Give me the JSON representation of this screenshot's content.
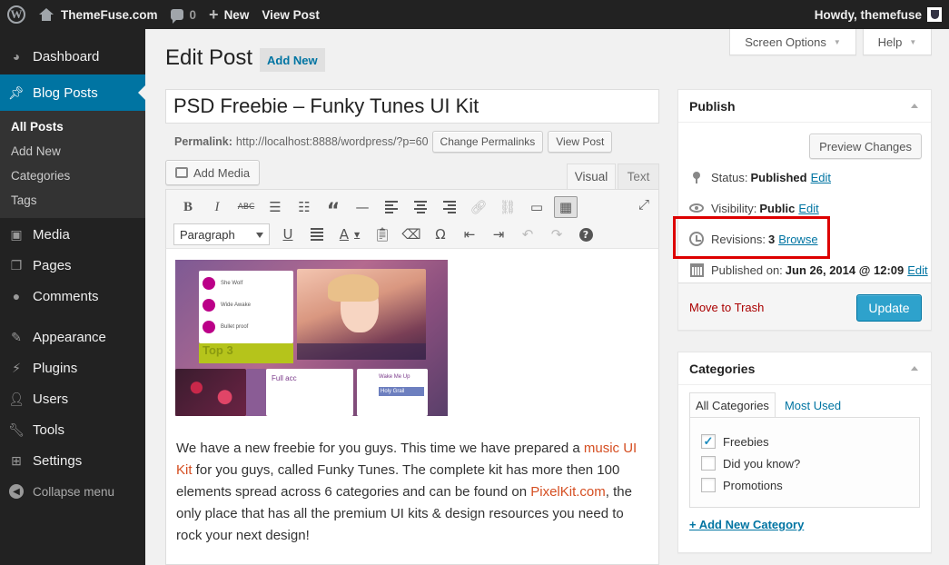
{
  "adminbar": {
    "site_name": "ThemeFuse.com",
    "comments_count": "0",
    "new_label": "New",
    "view_post": "View Post",
    "howdy": "Howdy, themefuse"
  },
  "sidebar": {
    "items": [
      {
        "label": "Dashboard",
        "icon": "dashboard-icon"
      },
      {
        "label": "Blog Posts",
        "icon": "pushpin-icon",
        "current": true
      },
      {
        "label": "Media",
        "icon": "media-icon"
      },
      {
        "label": "Pages",
        "icon": "pages-icon"
      },
      {
        "label": "Comments",
        "icon": "comments-icon"
      },
      {
        "label": "Appearance",
        "icon": "brush-icon"
      },
      {
        "label": "Plugins",
        "icon": "plugin-icon"
      },
      {
        "label": "Users",
        "icon": "users-icon"
      },
      {
        "label": "Tools",
        "icon": "wrench-icon"
      },
      {
        "label": "Settings",
        "icon": "settings-icon"
      }
    ],
    "submenu": [
      "All Posts",
      "Add New",
      "Categories",
      "Tags"
    ],
    "collapse": "Collapse menu"
  },
  "screen_options": "Screen Options",
  "help": "Help",
  "page": {
    "title": "Edit Post",
    "add_new": "Add New"
  },
  "post": {
    "title": "PSD Freebie – Funky Tunes UI Kit",
    "permalink_label": "Permalink:",
    "permalink_url": "http://localhost:8888/wordpress/?p=60",
    "change_permalinks": "Change Permalinks",
    "view_post": "View Post"
  },
  "editor": {
    "add_media": "Add Media",
    "tab_visual": "Visual",
    "tab_text": "Text",
    "format": "Paragraph",
    "image_text": {
      "r1": "She Wolf",
      "r2": "Wide Awake",
      "r3": "Bullet proof",
      "top": "Top 3",
      "full": "Full acc",
      "wake": "Wake Me Up",
      "holy": "Holy Grail"
    },
    "content": {
      "p1a": "We have a new freebie for you guys. This time we have prepared a ",
      "link1": "music UI Kit",
      "p1b": " for you guys, called Funky Tunes. The complete kit has more then 100 elements spread across 6 categories and can be found on ",
      "link2": "PixelKit.com",
      "p1c": ", the only place that has all the premium UI kits & design resources you need to rock your next design!"
    }
  },
  "publish": {
    "title": "Publish",
    "preview": "Preview Changes",
    "status_label": "Status:",
    "status_value": "Published",
    "visibility_label": "Visibility:",
    "visibility_value": "Public",
    "revisions_label": "Revisions:",
    "revisions_value": "3",
    "browse": "Browse",
    "published_on_label": "Published on:",
    "published_on_value": "Jun 26, 2014 @ 12:09",
    "edit": "Edit",
    "trash": "Move to Trash",
    "update": "Update"
  },
  "categories": {
    "title": "Categories",
    "tab_all": "All Categories",
    "tab_used": "Most Used",
    "items": [
      {
        "label": "Freebies",
        "checked": true
      },
      {
        "label": "Did you know?",
        "checked": false
      },
      {
        "label": "Promotions",
        "checked": false
      }
    ],
    "add_new": "+ Add New Category"
  },
  "colors": {
    "admin_bar": "#222222",
    "menu_current": "#0074a2",
    "link": "#0074a2",
    "update_button": "#2ea2cc",
    "trash": "#aa0000",
    "post_link": "#d54e21",
    "highlight": "#dd0000"
  }
}
